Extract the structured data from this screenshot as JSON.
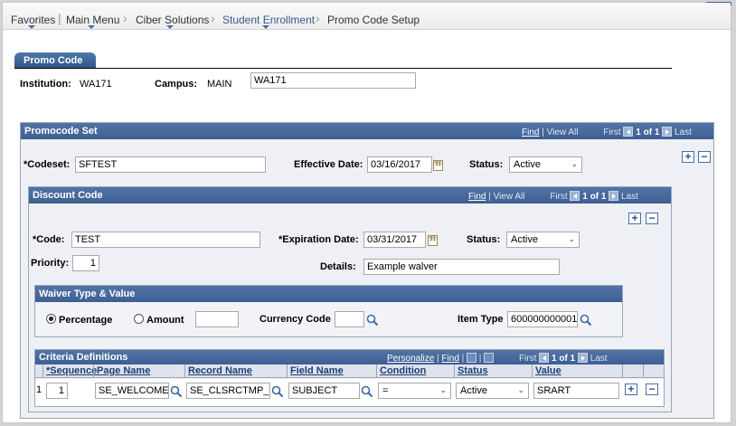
{
  "nav": {
    "items": [
      {
        "label": "Favorites",
        "dropdown": true
      },
      {
        "label": "Main Menu",
        "dropdown": true
      },
      {
        "label": "Ciber Solutions",
        "dropdown": true
      },
      {
        "label": "Student Enrollment",
        "dropdown": true
      },
      {
        "label": "Promo Code Setup",
        "dropdown": false
      }
    ]
  },
  "tab": {
    "label": "Promo Code"
  },
  "header": {
    "institution_label": "Institution:",
    "institution_value": "WA171",
    "campus_label": "Campus:",
    "campus_value": "MAIN",
    "campus_desc": "WA171"
  },
  "promocode_set": {
    "title": "Promocode Set",
    "find": "Find",
    "view_all": "View All",
    "first": "First",
    "range": "1 of 1",
    "last": "Last",
    "codeset_label": "*Codeset:",
    "codeset_value": "SFTEST",
    "effdate_label": "Effective Date:",
    "effdate_value": "03/16/2017",
    "status_label": "Status:",
    "status_value": "Active"
  },
  "discount_code": {
    "title": "Discount Code",
    "find": "Find",
    "view_all": "View All",
    "first": "First",
    "range": "1 of 1",
    "last": "Last",
    "code_label": "*Code:",
    "code_value": "TEST",
    "expdate_label": "*Expiration Date:",
    "expdate_value": "03/31/2017",
    "status_label": "Status:",
    "status_value": "Active",
    "priority_label": "Priority:",
    "priority_value": "1",
    "details_label": "Details:",
    "details_value": "Example walver"
  },
  "waiver": {
    "title": "Waiver Type & Value",
    "percentage_label": "Percentage",
    "amount_label": "Amount",
    "amount_value": "",
    "currency_label": "Currency Code",
    "currency_value": "",
    "item_type_label": "Item Type",
    "item_type_value": "600000000001"
  },
  "criteria": {
    "title": "Criteria Definitions",
    "personalize": "Personalize",
    "find": "Find",
    "first": "First",
    "range": "1 of 1",
    "last": "Last",
    "columns": [
      "*Sequence",
      "Page Name",
      "Record Name",
      "Field Name",
      "Condition",
      "Status",
      "Value"
    ],
    "rows": [
      {
        "row_num": "1",
        "sequence": "1",
        "page_name": "SE_WELCOME",
        "record_name": "SE_CLSRCTMP_T",
        "field_name": "SUBJECT",
        "condition": "=",
        "status": "Active",
        "value": "SRART"
      }
    ]
  }
}
